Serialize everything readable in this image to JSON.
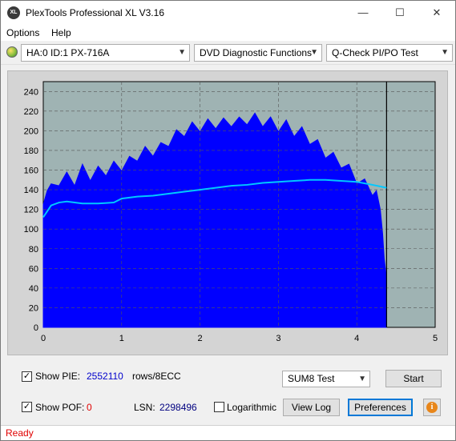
{
  "window": {
    "title": "PlexTools Professional XL V3.16",
    "app_icon_text": "XL",
    "minimize": "—",
    "maximize": "☐",
    "close": "✕"
  },
  "menu": {
    "options": "Options",
    "help": "Help"
  },
  "toolbar": {
    "drive": "HA:0 ID:1  PX-716A",
    "function": "DVD Diagnostic Functions",
    "test": "Q-Check PI/PO Test"
  },
  "chart_data": {
    "type": "area",
    "x_ticks": [
      "0",
      "1",
      "2",
      "3",
      "4",
      "5"
    ],
    "y_ticks": [
      "0",
      "20",
      "40",
      "60",
      "80",
      "100",
      "120",
      "140",
      "160",
      "180",
      "200",
      "220",
      "240"
    ],
    "xlim": [
      0,
      5
    ],
    "ylim": [
      0,
      250
    ],
    "grid": true,
    "end_marker_x": 4.38,
    "series": [
      {
        "type": "area",
        "color": "#0000ff",
        "x": [
          0.0,
          0.05,
          0.1,
          0.2,
          0.3,
          0.4,
          0.5,
          0.6,
          0.7,
          0.8,
          0.9,
          1.0,
          1.1,
          1.2,
          1.3,
          1.4,
          1.5,
          1.6,
          1.7,
          1.8,
          1.9,
          2.0,
          2.1,
          2.2,
          2.3,
          2.4,
          2.5,
          2.6,
          2.7,
          2.8,
          2.9,
          3.0,
          3.1,
          3.2,
          3.3,
          3.4,
          3.5,
          3.6,
          3.7,
          3.8,
          3.9,
          4.0,
          4.1,
          4.2,
          4.25,
          4.3,
          4.33,
          4.35,
          4.38
        ],
        "values": [
          125,
          145,
          140,
          150,
          152,
          150,
          160,
          155,
          158,
          160,
          163,
          165,
          168,
          175,
          178,
          180,
          182,
          190,
          195,
          200,
          203,
          205,
          206,
          208,
          207,
          210,
          208,
          212,
          212,
          210,
          208,
          205,
          205,
          200,
          198,
          192,
          185,
          178,
          172,
          168,
          160,
          152,
          145,
          140,
          133,
          120,
          95,
          70,
          50
        ]
      },
      {
        "type": "line",
        "color": "#00c8ff",
        "x": [
          0.0,
          0.05,
          0.1,
          0.2,
          0.3,
          0.5,
          0.7,
          0.9,
          1.0,
          1.2,
          1.4,
          1.6,
          1.8,
          2.0,
          2.2,
          2.4,
          2.6,
          2.8,
          3.0,
          3.2,
          3.4,
          3.6,
          3.8,
          4.0,
          4.2,
          4.38
        ],
        "values": [
          112,
          118,
          124,
          127,
          128,
          126,
          126,
          127,
          131,
          133,
          134,
          136,
          138,
          140,
          142,
          144,
          145,
          147,
          148,
          149,
          150,
          150,
          149,
          148,
          145,
          142
        ]
      }
    ]
  },
  "controls": {
    "show_pie_label": "Show PIE:",
    "pie_value": "2552110",
    "pie_unit": "rows/8ECC",
    "show_pof_label": "Show POF:",
    "pof_value": "0",
    "lsn_label": "LSN:",
    "lsn_value": "2298496",
    "logarithmic_label": "Logarithmic",
    "sum8_select": "SUM8 Test",
    "start_button": "Start",
    "view_log_button": "View Log",
    "preferences_button": "Preferences",
    "info_icon": "i",
    "check_mark": "✓"
  },
  "status": {
    "text": "Ready",
    "color": "#e00000"
  },
  "colors": {
    "plot_bg": "#9fb3b3",
    "pie_value": "#0000cc",
    "pof_value": "#e00000"
  }
}
